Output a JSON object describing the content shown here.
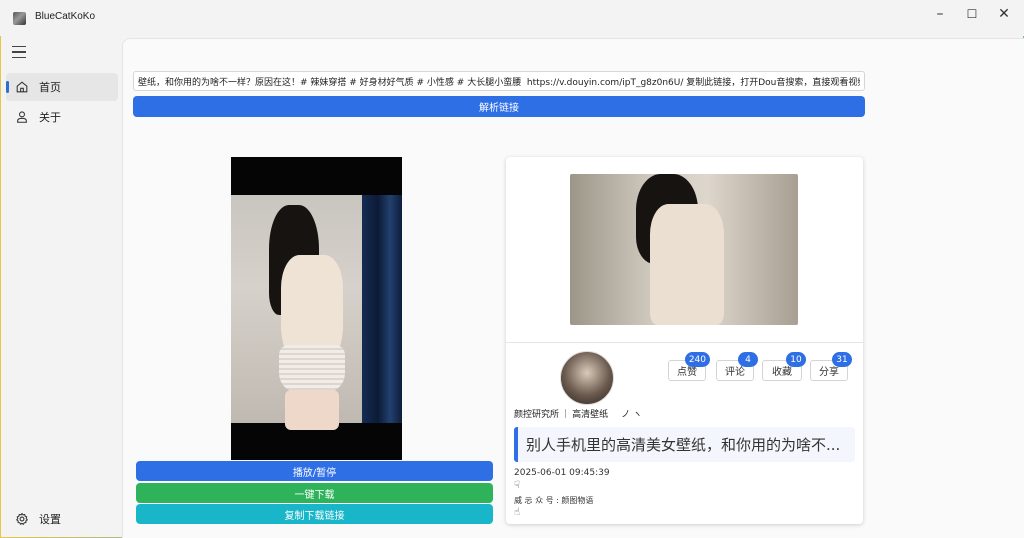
{
  "window": {
    "title": "BlueCatKoKo",
    "controls": {
      "minimize": "–",
      "maximize": "☐",
      "close": "✕"
    }
  },
  "sidebar": {
    "items": [
      {
        "label": "首页",
        "icon": "home-icon"
      },
      {
        "label": "关于",
        "icon": "person-icon"
      }
    ],
    "settings_label": "设置"
  },
  "main": {
    "link_input_value": "壁纸，和你用的为啥不一样？原因在这！# 辣妹穿搭 # 好身材好气质 # 小性感 # 大长腿小蛮腰  https://v.douyin.com/ipT_g8z0n6U/ 复制此链接，打开Dou音搜索，直接观看视频！",
    "parse_button": "解析链接",
    "play_button": "播放/暂停",
    "download_button": "一键下载",
    "copy_button": "复制下载链接"
  },
  "video_card": {
    "stats": [
      {
        "label": "点赞",
        "count": "240"
      },
      {
        "label": "评论",
        "count": "4"
      },
      {
        "label": "收藏",
        "count": "10"
      },
      {
        "label": "分享",
        "count": "31"
      }
    ],
    "author": "颜控研究所",
    "author_separator": "|",
    "tag": "高清壁纸",
    "author_marks": "ノ  ヽ",
    "description": "别人手机里的高清美女壁纸，和你用的为啥不...",
    "publish_time": "2025-06-01 09:45:39",
    "hand_icon_top": "☟",
    "wechat": "威 忈 众 号 : 颜图物语",
    "hand_icon_bottom": "☝"
  },
  "colors": {
    "primary": "#2f6fe6",
    "success": "#2fb35a",
    "cyan": "#19b6c9"
  }
}
